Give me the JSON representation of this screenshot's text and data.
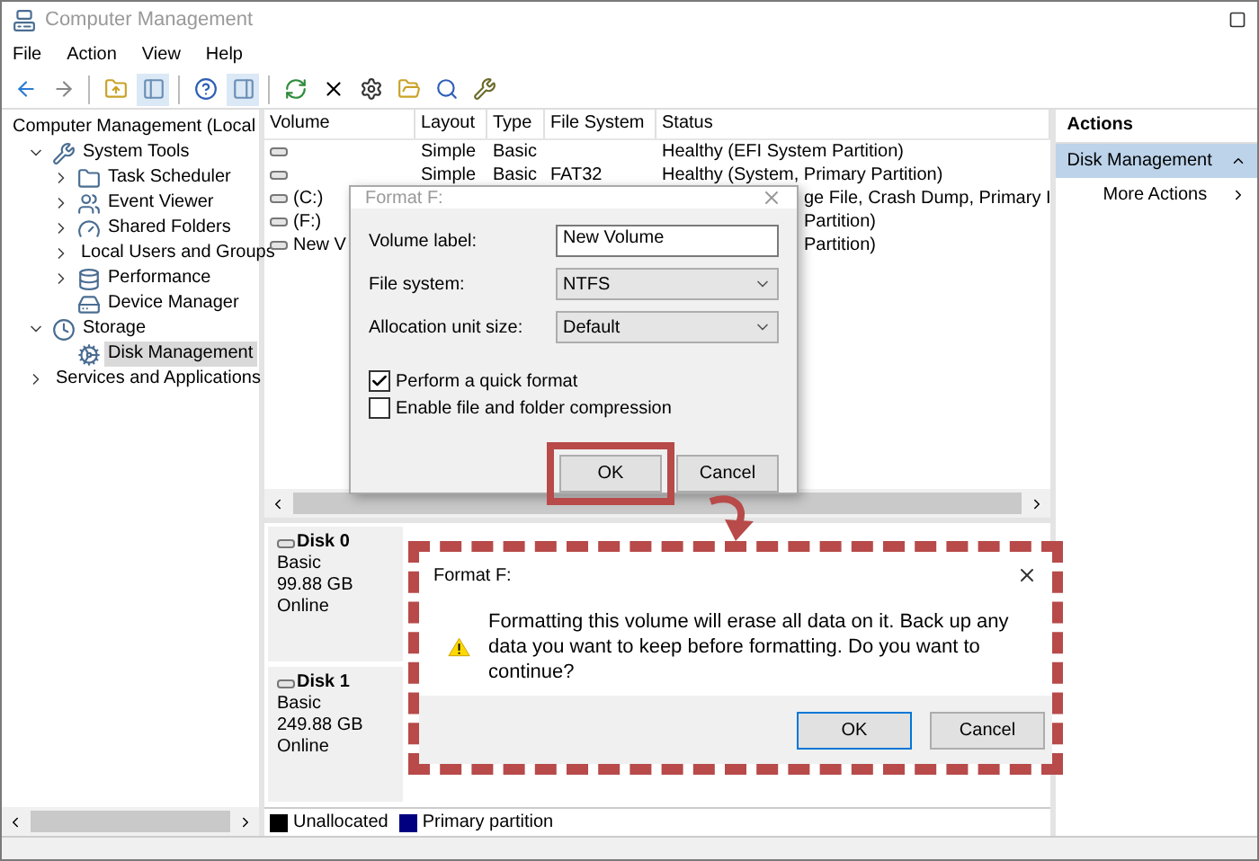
{
  "window": {
    "title": "Computer Management"
  },
  "menu": [
    "File",
    "Action",
    "View",
    "Help"
  ],
  "tree": [
    {
      "label": "Computer Management (Local",
      "selected": false,
      "children": [
        {
          "label": "System Tools",
          "selected": false,
          "expanded": true,
          "children": [
            {
              "label": "Task Scheduler",
              "selected": false,
              "expanded": false
            },
            {
              "label": "Event Viewer",
              "selected": false,
              "expanded": false
            },
            {
              "label": "Shared Folders",
              "selected": false,
              "expanded": false
            },
            {
              "label": "Local Users and Groups",
              "selected": false,
              "expanded": false
            },
            {
              "label": "Performance",
              "selected": false,
              "expanded": false
            },
            {
              "label": "Device Manager",
              "selected": false
            }
          ]
        },
        {
          "label": "Storage",
          "selected": false,
          "expanded": true,
          "children": [
            {
              "label": "Disk Management",
              "selected": true
            }
          ]
        },
        {
          "label": "Services and Applications",
          "selected": false,
          "expanded": false
        }
      ]
    }
  ],
  "table": {
    "columns": [
      "Volume",
      "Layout",
      "Type",
      "File System",
      "Status"
    ],
    "rows": [
      {
        "kind": "full",
        "cells": [
          "",
          "Simple",
          "Basic",
          "",
          "Healthy (EFI System Partition)"
        ]
      },
      {
        "kind": "full",
        "cells": [
          "",
          "Simple",
          "Basic",
          "FAT32",
          "Healthy (System, Primary Partition)"
        ]
      },
      {
        "kind": "partial",
        "cells": [
          "(C:)",
          "ge File, Crash Dump, Primary I"
        ]
      },
      {
        "kind": "partial",
        "cells": [
          "(F:)",
          "Partition)"
        ]
      },
      {
        "kind": "partial",
        "cells": [
          "New V",
          "Partition)"
        ]
      }
    ]
  },
  "disks": [
    {
      "name": "Disk 0",
      "type": "Basic",
      "size": "99.88 GB",
      "status": "Online"
    },
    {
      "name": "Disk 1",
      "type": "Basic",
      "size": "249.88 GB",
      "status": "Online"
    }
  ],
  "legend": [
    {
      "label": "Unallocated",
      "color": "#000000"
    },
    {
      "label": "Primary partition",
      "color": "#000080"
    }
  ],
  "actions": {
    "header": "Actions",
    "section": "Disk Management",
    "items": [
      "More Actions"
    ]
  },
  "format_dialog": {
    "title": "Format F:",
    "fields": [
      {
        "kind": "text",
        "label": "Volume label:",
        "value": "New Volume"
      },
      {
        "kind": "select",
        "label": "File system:",
        "value": "NTFS"
      },
      {
        "kind": "select",
        "label": "Allocation unit size:",
        "value": "Default"
      }
    ],
    "options": [
      {
        "label": "Perform a quick format",
        "checked": true
      },
      {
        "label": "Enable file and folder compression",
        "checked": false
      }
    ],
    "buttons": [
      {
        "label": "OK",
        "highlighted": true
      },
      {
        "label": "Cancel",
        "highlighted": false
      }
    ]
  },
  "confirm_dialog": {
    "title": "Format F:",
    "message": "Formatting this volume will erase all data on it. Back up any data you want to keep before formatting. Do you want to continue?",
    "buttons": [
      {
        "label": "OK",
        "selected": true
      },
      {
        "label": "Cancel",
        "selected": false
      }
    ]
  }
}
